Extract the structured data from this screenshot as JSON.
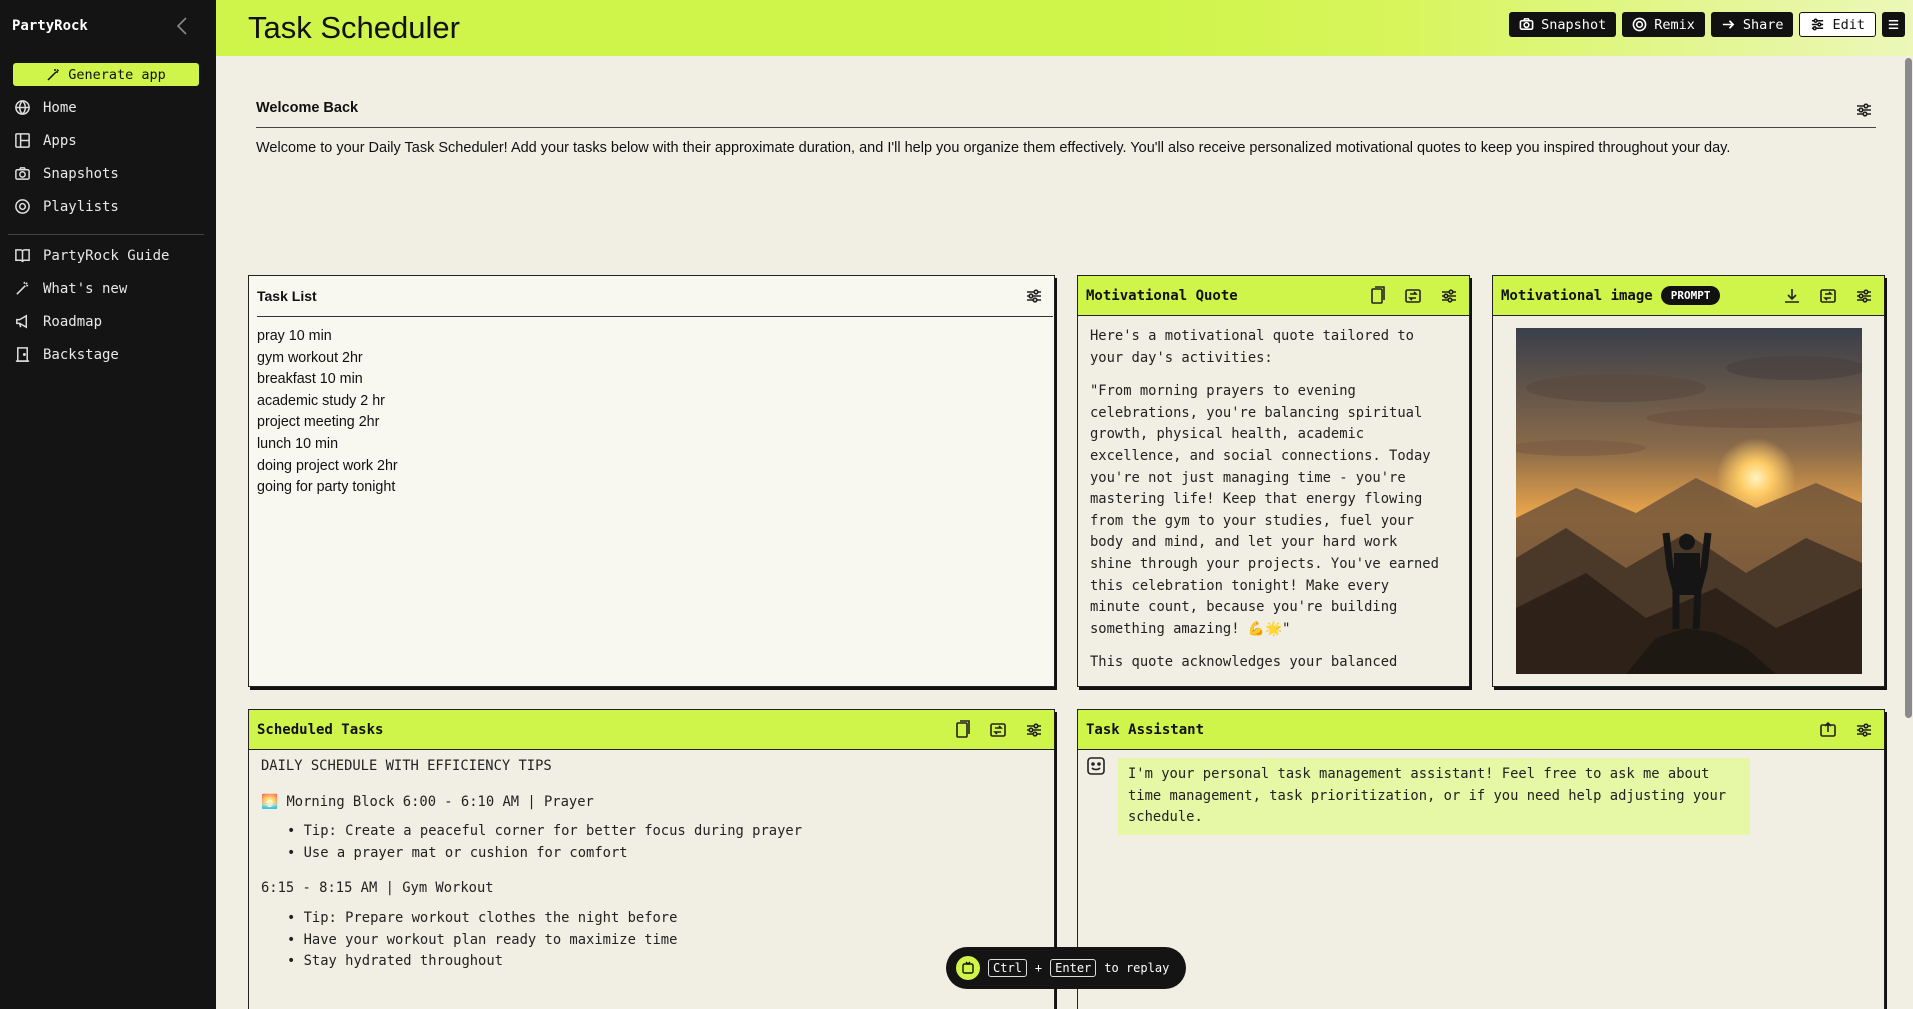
{
  "sidebar": {
    "brand": "PartyRock",
    "generate_label": "Generate app",
    "items": [
      {
        "label": "Home"
      },
      {
        "label": "Apps"
      },
      {
        "label": "Snapshots"
      },
      {
        "label": "Playlists"
      }
    ],
    "secondary_items": [
      {
        "label": "PartyRock Guide"
      },
      {
        "label": "What's new"
      },
      {
        "label": "Roadmap"
      },
      {
        "label": "Backstage"
      }
    ]
  },
  "header": {
    "title": "Task Scheduler",
    "buttons": {
      "snapshot": "Snapshot",
      "remix": "Remix",
      "share": "Share",
      "edit": "Edit"
    }
  },
  "welcome": {
    "title": "Welcome Back",
    "text": "Welcome to your Daily Task Scheduler! Add your tasks below with their approximate duration, and I'll help you organize them effectively. You'll also receive personalized motivational quotes to keep you inspired throughout your day."
  },
  "task_list": {
    "title": "Task List",
    "items": [
      "pray 10 min",
      "gym workout 2hr",
      "breakfast 10 min",
      "academic study 2 hr",
      "project meeting 2hr",
      "lunch 10 min",
      "doing project work 2hr",
      "going for party tonight"
    ]
  },
  "quote": {
    "title": "Motivational Quote",
    "intro": "Here's a motivational quote tailored to your day's activities:",
    "text": "\"From morning prayers to evening celebrations, you're balancing spiritual growth, physical health, academic excellence, and social connections. Today you're not just managing time - you're mastering life! Keep that energy flowing from the gym to your studies, fuel your body and mind, and let your hard work shine through your projects. You've earned this celebration tonight! Make every minute count, because you're building something amazing! 💪🌟\"",
    "outro": "This quote acknowledges your balanced"
  },
  "image_widget": {
    "title": "Motivational image",
    "badge": "PROMPT"
  },
  "schedule": {
    "title": "Scheduled Tasks",
    "heading": "DAILY SCHEDULE WITH EFFICIENCY TIPS",
    "block1": "🌅 Morning Block 6:00 - 6:10 AM | Prayer",
    "block1_tips": [
      "Tip: Create a peaceful corner for better focus during prayer",
      "Use a prayer mat or cushion for comfort"
    ],
    "block2": "6:15 - 8:15 AM | Gym Workout",
    "block2_tips": [
      "Tip: Prepare workout clothes the night before",
      "Have your workout plan ready to maximize time",
      "Stay hydrated throughout"
    ]
  },
  "assistant": {
    "title": "Task Assistant",
    "message": "I'm your personal task management assistant! Feel free to ask me about time management, task prioritization, or if you need help adjusting your schedule."
  },
  "toast": {
    "key1": "Ctrl",
    "plus": "+",
    "key2": "Enter",
    "suffix": "to replay"
  }
}
